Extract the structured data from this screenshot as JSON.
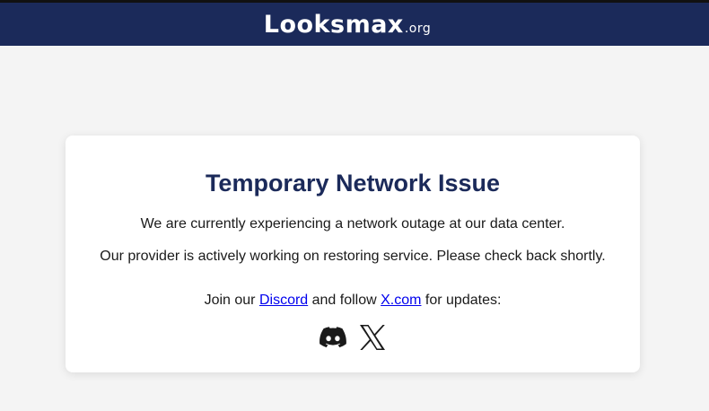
{
  "header": {
    "logo_main": "Looksmax",
    "logo_suffix": ".org",
    "background": "#1b2a5a"
  },
  "card": {
    "title": "Temporary Network Issue",
    "message_1": "We are currently experiencing a network outage at our data center.",
    "message_2": "Our provider is actively working on restoring service. Please check back shortly.",
    "follow_prefix": "Join our ",
    "discord_link": "Discord",
    "follow_middle": " and follow ",
    "x_link": "X.com",
    "follow_suffix": " for updates:",
    "icons": [
      "discord-icon",
      "x-icon"
    ]
  },
  "colors": {
    "accent": "#1b2a5a",
    "link": "#0000ee",
    "page_bg": "#f4f4f4"
  }
}
